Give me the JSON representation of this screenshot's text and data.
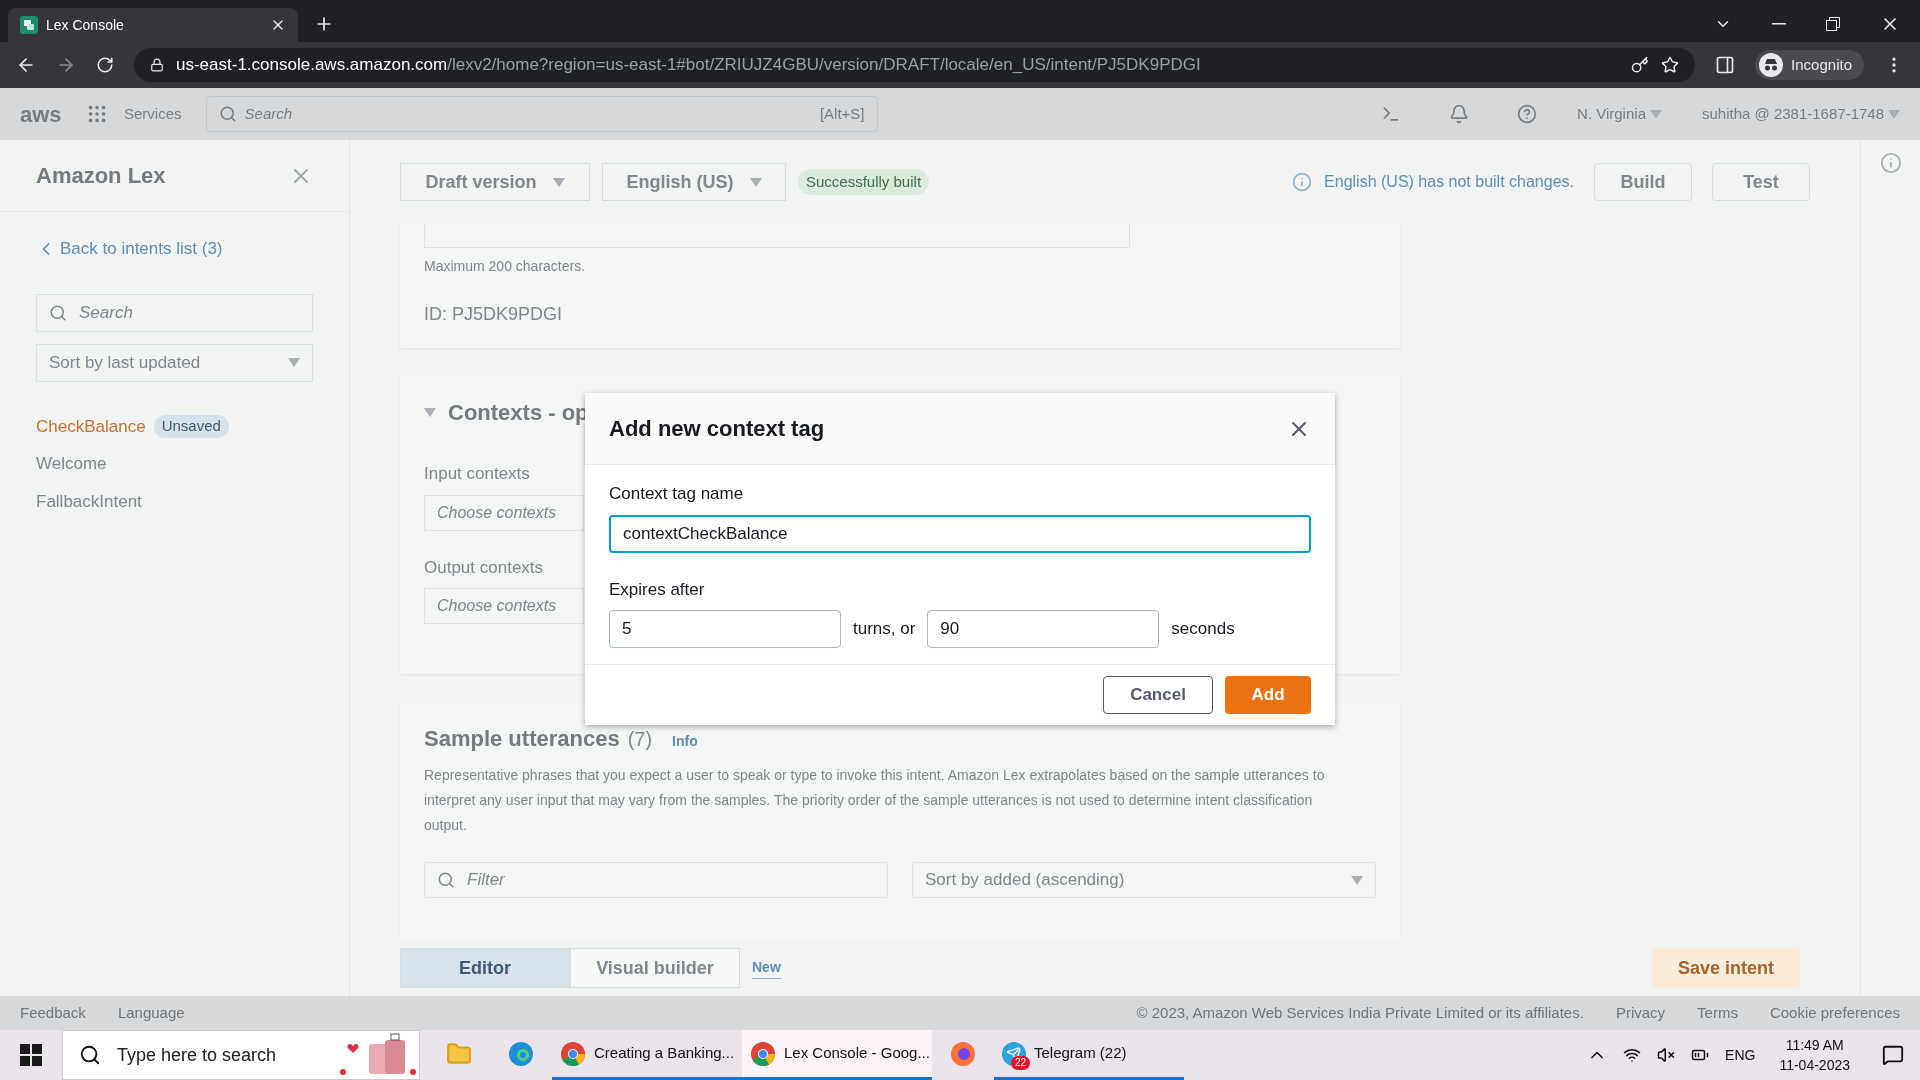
{
  "browser": {
    "tab": {
      "title": "Lex Console"
    },
    "url": {
      "domain": "us-east-1.console.aws.amazon.com",
      "path": "/lexv2/home?region=us-east-1#bot/ZRIUJZ4GBU/version/DRAFT/locale/en_US/intent/PJ5DK9PDGI"
    },
    "profile": "Incognito"
  },
  "aws_nav": {
    "logo": "aws",
    "services": "Services",
    "search": {
      "placeholder": "Search",
      "shortcut": "[Alt+S]"
    },
    "region": "N. Virginia",
    "account": "suhitha @ 2381-1687-1748"
  },
  "sidebar": {
    "title": "Amazon Lex",
    "back_link": "Back to intents list (3)",
    "search": {
      "placeholder": "Search"
    },
    "sort": "Sort by last updated",
    "intents": [
      {
        "name": "CheckBalance",
        "badge": "Unsaved",
        "selected": true
      },
      {
        "name": "Welcome",
        "selected": false
      },
      {
        "name": "FallbackIntent",
        "selected": false
      }
    ]
  },
  "header": {
    "version": "Draft version",
    "locale": "English (US)",
    "status": "Successfully built",
    "notice": "English (US) has not built changes.",
    "buttons": [
      "Build",
      "Test"
    ]
  },
  "details": {
    "hint": "Maximum 200 characters.",
    "id": "ID: PJ5DK9PDGI"
  },
  "contexts": {
    "title": "Contexts - op",
    "input_label": "Input contexts",
    "input_placeholder": "Choose contexts",
    "output_label": "Output contexts",
    "output_placeholder": "Choose contexts"
  },
  "utterances": {
    "title": "Sample utterances",
    "count": "(7)",
    "info": "Info",
    "description": "Representative phrases that you expect a user to speak or type to invoke this intent. Amazon Lex extrapolates based on the sample utterances to interpret any user input that may vary from the samples. The priority order of the sample utterances is not used to determine intent classification output.",
    "filter": {
      "placeholder": "Filter"
    },
    "sort": "Sort by added (ascending)"
  },
  "bottom_bar": {
    "tabs": [
      {
        "label": "Editor",
        "selected": true
      },
      {
        "label": "Visual builder",
        "selected": false
      }
    ],
    "new_badge": "New",
    "save": "Save intent"
  },
  "dialog": {
    "title": "Add new context tag",
    "name_label": "Context tag name",
    "name_value": "contextCheckBalance",
    "expires_label": "Expires after",
    "turns_value": "5",
    "turns_suffix": "turns, or",
    "seconds_value": "90",
    "seconds_suffix": "seconds",
    "buttons": [
      {
        "label": "Cancel",
        "kind": "secondary"
      },
      {
        "label": "Add",
        "kind": "primary"
      }
    ]
  },
  "footer": {
    "left": [
      "Feedback",
      "Language"
    ],
    "copyright": "© 2023, Amazon Web Services India Private Limited or its affiliates.",
    "right": [
      "Privacy",
      "Terms",
      "Cookie preferences"
    ]
  },
  "taskbar": {
    "search_placeholder": "Type here to search",
    "apps": [
      {
        "kind": "explorer",
        "selected": false
      },
      {
        "kind": "edge",
        "selected": false
      },
      {
        "kind": "chrome",
        "label": "Creating a Banking...",
        "selected": false
      },
      {
        "kind": "chrome",
        "label": "Lex Console - Goog...",
        "selected": true
      },
      {
        "kind": "firefox",
        "selected": false
      },
      {
        "kind": "telegram",
        "label": "Telegram (22)",
        "badge": "22",
        "selected": false
      }
    ],
    "language": "ENG",
    "time": "11:49 AM",
    "date": "11-04-2023"
  }
}
